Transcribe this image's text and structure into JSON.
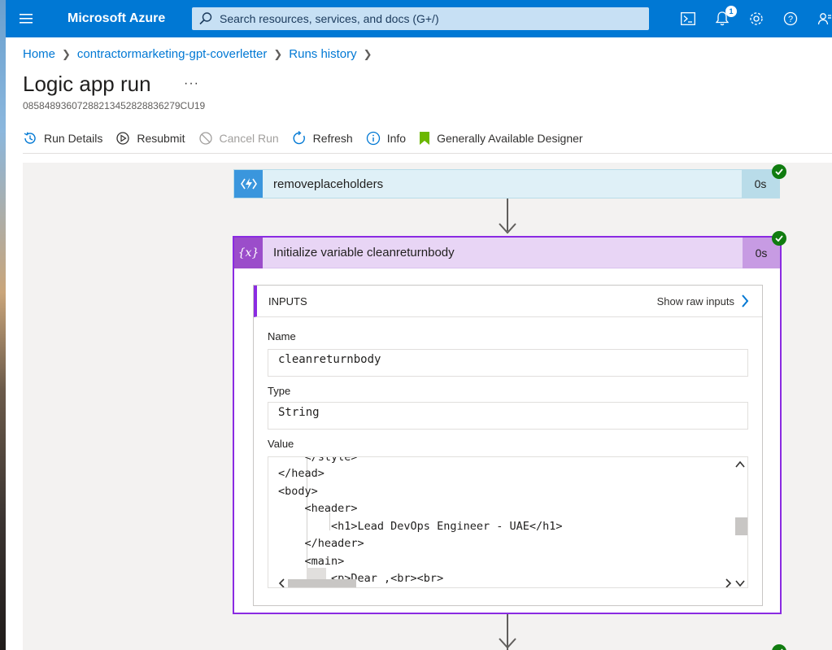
{
  "topbar": {
    "brand": "Microsoft Azure",
    "search_placeholder": "Search resources, services, and docs (G+/)",
    "notification_count": "1",
    "icons": [
      "menu-icon",
      "cloud-shell-icon",
      "bell-icon",
      "gear-icon",
      "help-icon",
      "feedback-icon"
    ]
  },
  "breadcrumb": {
    "items": [
      "Home",
      "contractormarketing-gpt-coverletter",
      "Runs history"
    ]
  },
  "page": {
    "title": "Logic app run",
    "more": "···",
    "run_id": "08584893607288213452828836279CU19"
  },
  "toolbar": {
    "run_details": "Run Details",
    "resubmit": "Resubmit",
    "cancel_run": "Cancel Run",
    "refresh": "Refresh",
    "info": "Info",
    "designer": "Generally Available Designer"
  },
  "colors": {
    "accent": "#0078d4",
    "variable_border": "#8a2be2",
    "success": "#107c10",
    "designer_flag": "#6bb700"
  },
  "steps": {
    "prev": {
      "title": "removeplaceholders",
      "duration": "0s",
      "status": "succeeded"
    },
    "current": {
      "title": "Initialize variable cleanreturnbody",
      "duration": "0s",
      "status": "succeeded",
      "icon_text": "{x}",
      "inputs": {
        "header": "INPUTS",
        "show_raw": "Show raw inputs",
        "name_label": "Name",
        "name_value": "cleanreturnbody",
        "type_label": "Type",
        "type_value": "String",
        "value_label": "Value",
        "value_lines": [
          "    </style>",
          "</head>",
          "<body>",
          "    <header>",
          "        <h1>Lead DevOps Engineer - UAE</h1>",
          "    </header>",
          "    <main>",
          "        <p>Dear ,<br><br>"
        ]
      }
    },
    "next": {
      "status": "succeeded"
    }
  }
}
